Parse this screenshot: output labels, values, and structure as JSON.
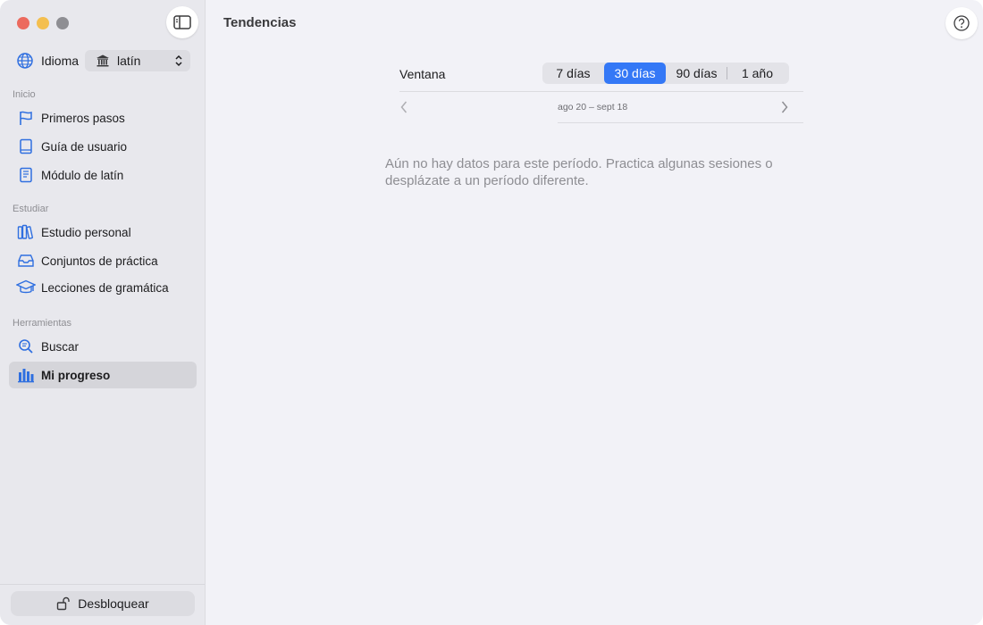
{
  "sidebar": {
    "language_label": "Idioma",
    "language_value": "latín",
    "sections": [
      {
        "title": "Inicio",
        "items": [
          {
            "label": "Primeros pasos",
            "icon": "flag-icon"
          },
          {
            "label": "Guía de usuario",
            "icon": "book-icon"
          },
          {
            "label": "Módulo de latín",
            "icon": "module-book-icon"
          }
        ]
      },
      {
        "title": "Estudiar",
        "items": [
          {
            "label": "Estudio personal",
            "icon": "books-icon"
          },
          {
            "label": "Conjuntos de práctica",
            "icon": "tray-icon"
          },
          {
            "label": "Lecciones de gramática",
            "icon": "graduation-cap-icon"
          }
        ]
      },
      {
        "title": "Herramientas",
        "items": [
          {
            "label": "Buscar",
            "icon": "search-icon"
          },
          {
            "label": "Mi progreso",
            "icon": "bar-chart-icon"
          }
        ]
      }
    ],
    "unlock_label": "Desbloquear"
  },
  "main": {
    "title": "Tendencias",
    "window_label": "Ventana",
    "segments": [
      "7 días",
      "30 días",
      "90 días",
      "1 año"
    ],
    "selected_segment": "30 días",
    "range_text": "ago 20 – sept 18",
    "empty_message": "Aún no hay datos para este período. Practica algunas sesiones o desplázate a un período diferente."
  },
  "colors": {
    "accent": "#3478f6",
    "sidebar_bg": "#e8e8ed",
    "main_bg": "#f2f2f7"
  }
}
